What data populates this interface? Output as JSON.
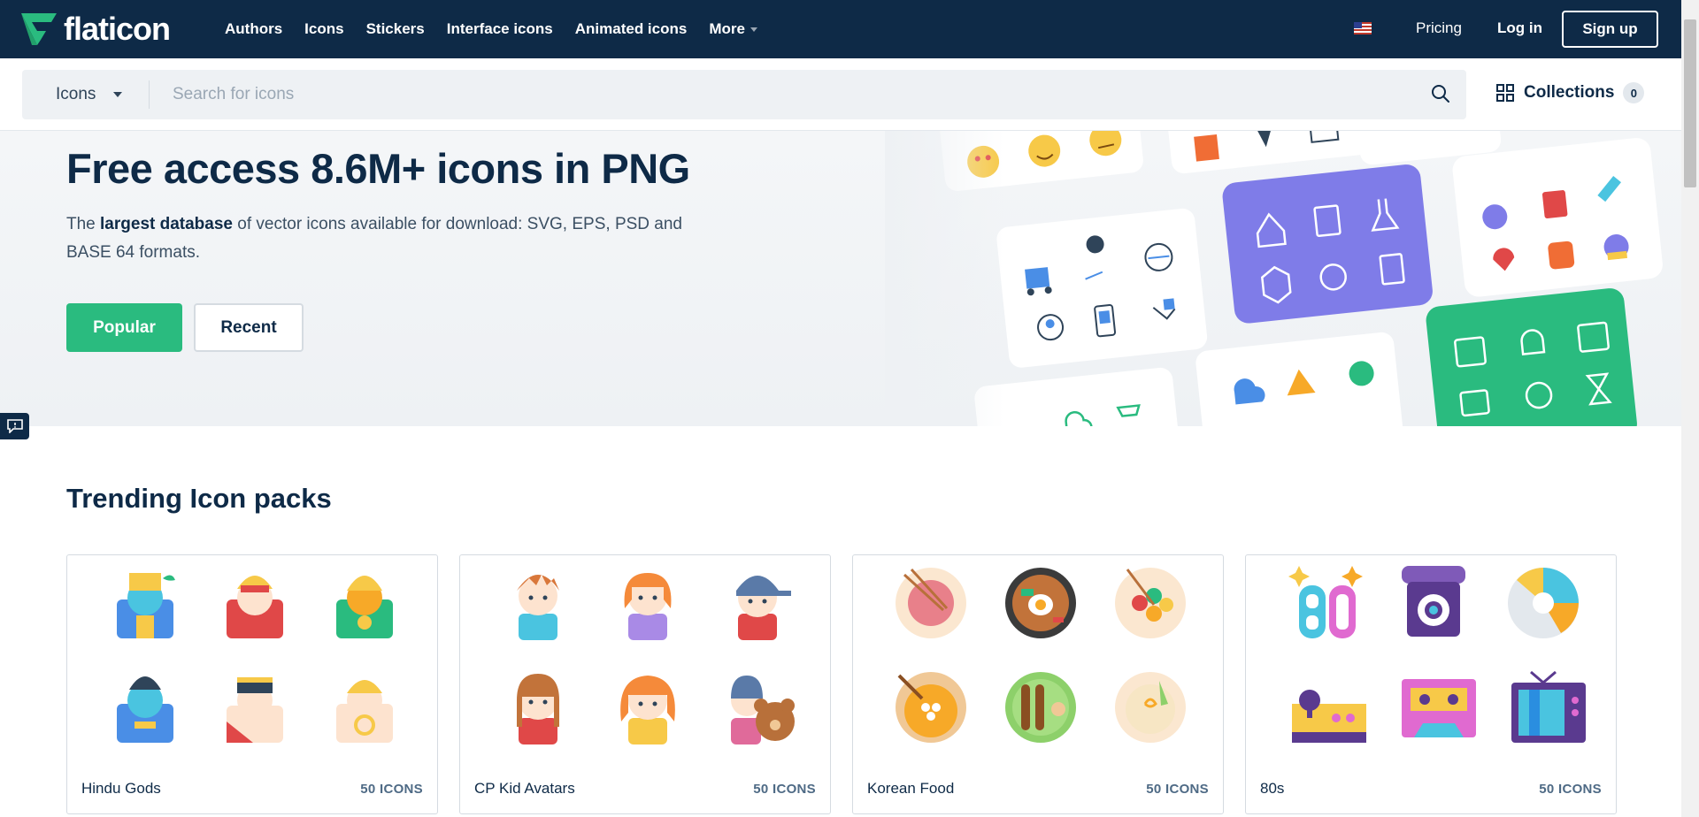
{
  "header": {
    "logo_text": "flaticon",
    "nav": [
      "Authors",
      "Icons",
      "Stickers",
      "Interface icons",
      "Animated icons"
    ],
    "more_label": "More",
    "pricing": "Pricing",
    "login": "Log in",
    "signup": "Sign up",
    "brand_color": "#0e2a47",
    "accent": "#2abb7f"
  },
  "search": {
    "type": "Icons",
    "placeholder": "Search for icons",
    "collections_label": "Collections",
    "collections_count": "0"
  },
  "hero": {
    "title": "Free access 8.6M+ icons in PNG",
    "desc_pre": "The ",
    "desc_bold": "largest database",
    "desc_post": " of vector icons available for download: SVG, EPS, PSD and BASE 64 formats.",
    "popular": "Popular",
    "recent": "Recent"
  },
  "trending": {
    "title": "Trending Icon packs",
    "packs": [
      {
        "name": "Hindu Gods",
        "count": "50 ICONS"
      },
      {
        "name": "CP Kid Avatars",
        "count": "50 ICONS"
      },
      {
        "name": "Korean Food",
        "count": "50 ICONS"
      },
      {
        "name": "80s",
        "count": "50 ICONS"
      }
    ]
  }
}
